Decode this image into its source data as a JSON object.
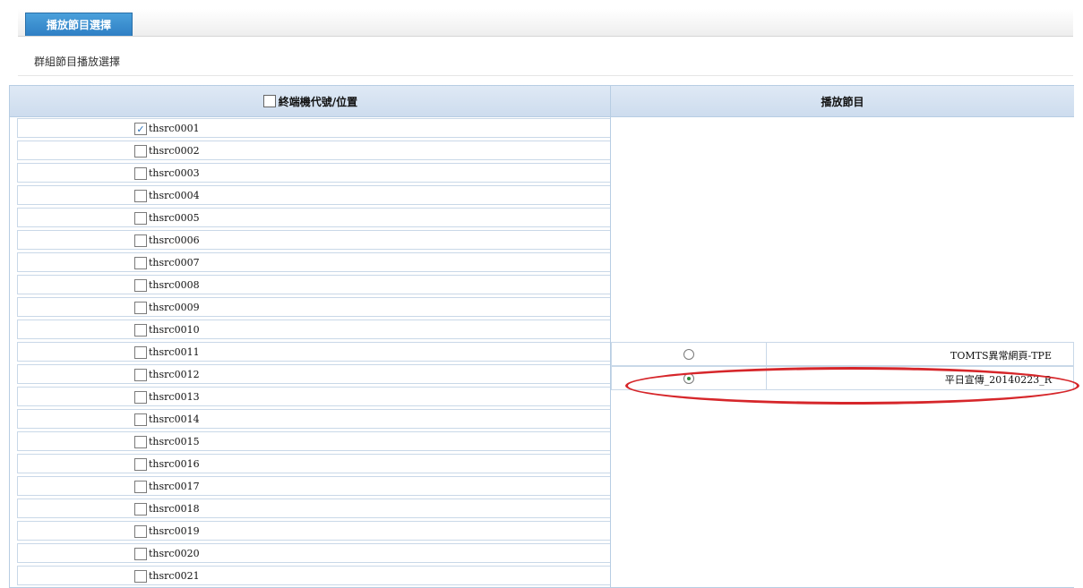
{
  "tab": {
    "label": "播放節目選擇"
  },
  "section": {
    "label": "群組節目播放選擇"
  },
  "table": {
    "left_header": "終端機代號/位置",
    "right_header": "播放節目"
  },
  "terminals": [
    {
      "code": "thsrc0001",
      "checked": true
    },
    {
      "code": "thsrc0002",
      "checked": false
    },
    {
      "code": "thsrc0003",
      "checked": false
    },
    {
      "code": "thsrc0004",
      "checked": false
    },
    {
      "code": "thsrc0005",
      "checked": false
    },
    {
      "code": "thsrc0006",
      "checked": false
    },
    {
      "code": "thsrc0007",
      "checked": false
    },
    {
      "code": "thsrc0008",
      "checked": false
    },
    {
      "code": "thsrc0009",
      "checked": false
    },
    {
      "code": "thsrc0010",
      "checked": false
    },
    {
      "code": "thsrc0011",
      "checked": false
    },
    {
      "code": "thsrc0012",
      "checked": false
    },
    {
      "code": "thsrc0013",
      "checked": false
    },
    {
      "code": "thsrc0014",
      "checked": false
    },
    {
      "code": "thsrc0015",
      "checked": false
    },
    {
      "code": "thsrc0016",
      "checked": false
    },
    {
      "code": "thsrc0017",
      "checked": false
    },
    {
      "code": "thsrc0018",
      "checked": false
    },
    {
      "code": "thsrc0019",
      "checked": false
    },
    {
      "code": "thsrc0020",
      "checked": false
    },
    {
      "code": "thsrc0021",
      "checked": false
    }
  ],
  "programs": [
    {
      "name": "TOMTS異常網頁-TPE",
      "selected": false
    },
    {
      "name": "平日宣傳_20140223_R",
      "selected": true
    }
  ],
  "colors": {
    "tab": "#2f7fc4",
    "highlight_ring": "#d6262a"
  }
}
